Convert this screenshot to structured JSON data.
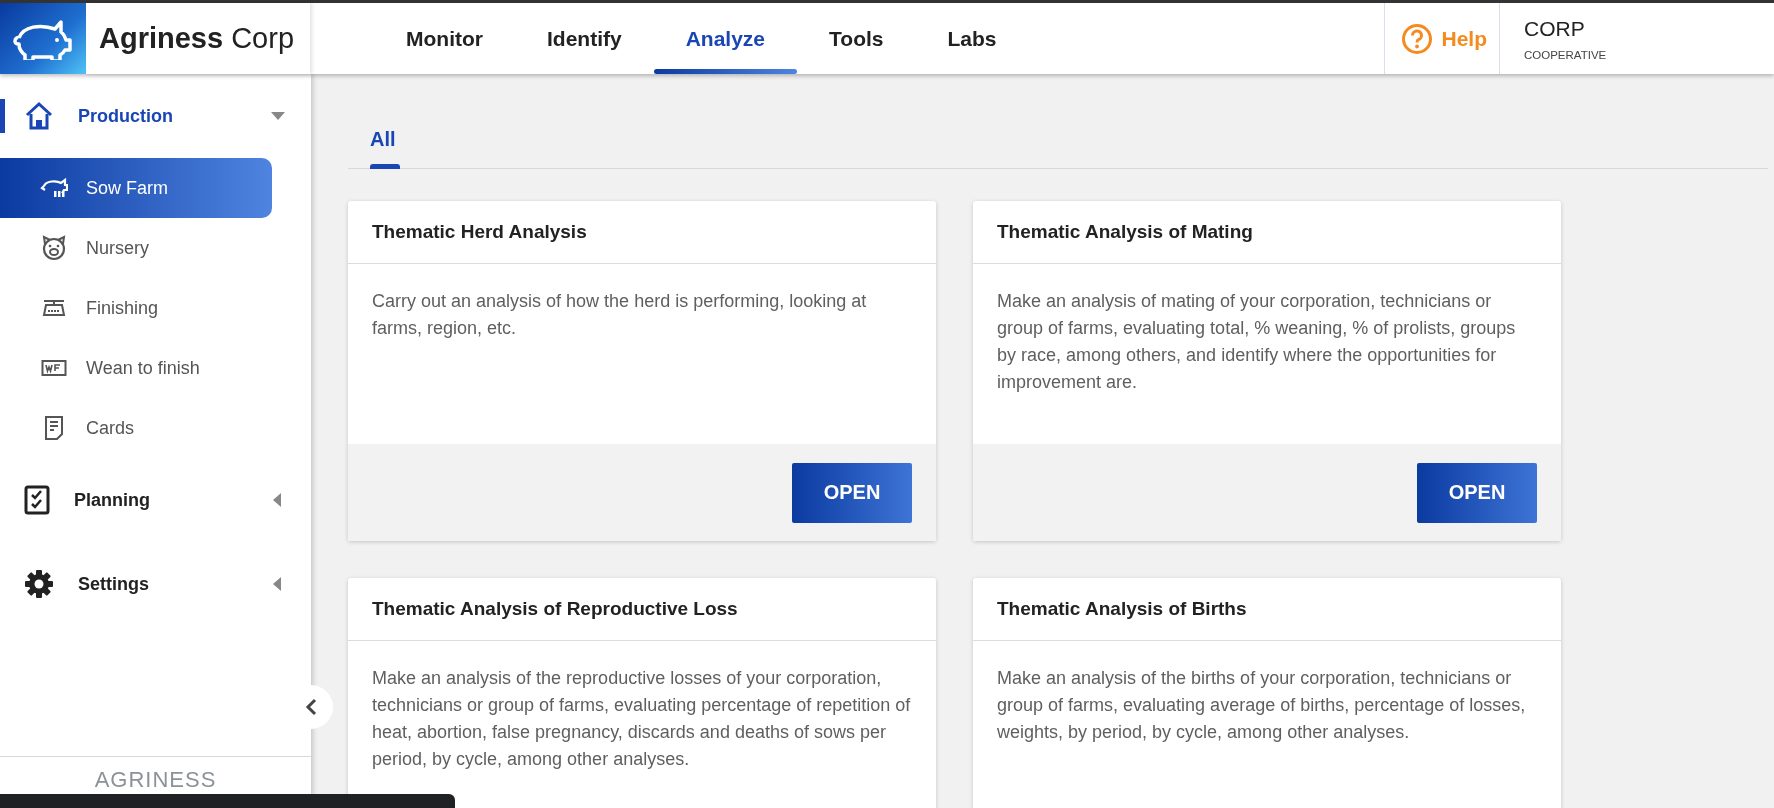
{
  "header": {
    "brand": "**Agriness** Corp",
    "nav": [
      {
        "label": "Monitor",
        "selected": false
      },
      {
        "label": "Identify",
        "selected": false
      },
      {
        "label": "Analyze",
        "selected": true
      },
      {
        "label": "Tools",
        "selected": false
      },
      {
        "label": "Labs",
        "selected": false
      }
    ],
    "help": "Help",
    "account": {
      "name": "CORP",
      "role": "COOPERATIVE"
    }
  },
  "sidebar": {
    "sections": [
      {
        "label": "Production",
        "selected": true,
        "expanded": true,
        "children": [
          {
            "label": "Sow Farm",
            "selected": true
          },
          {
            "label": "Nursery",
            "selected": false
          },
          {
            "label": "Finishing",
            "selected": false
          },
          {
            "label": "Wean to finish",
            "selected": false
          },
          {
            "label": "Cards",
            "selected": false
          }
        ]
      },
      {
        "label": "Planning",
        "selected": false,
        "expanded": false
      },
      {
        "label": "Settings",
        "selected": false,
        "expanded": false
      }
    ],
    "footer_logo": "AGRINESS"
  },
  "content": {
    "tabs": [
      {
        "label": "All",
        "selected": true
      }
    ],
    "cards": [
      {
        "title": "Thematic Herd Analysis",
        "description": "Carry out an analysis of how the herd is performing, looking at farms, region, etc.",
        "button": "OPEN"
      },
      {
        "title": "Thematic Analysis of Mating",
        "description": "Make an analysis of mating of your corporation, technicians or group of farms, evaluating total, % weaning, % of prolists, groups by race, among others, and identify where the opportunities for improvement are.",
        "button": "OPEN"
      },
      {
        "title": "Thematic Analysis of Reproductive Loss",
        "description": "Make an analysis of the reproductive losses of your corporation, technicians or group of farms, evaluating percentage of repetition of heat, abortion, false pregnancy, discards and deaths of sows per period, by cycle, among other analyses."
      },
      {
        "title": "Thematic Analysis of Births",
        "description": "Make an analysis of the births of your corporation, technicians or group of farms, evaluating average of births, percentage of losses, weights, by period, by cycle, among other analyses."
      }
    ]
  }
}
